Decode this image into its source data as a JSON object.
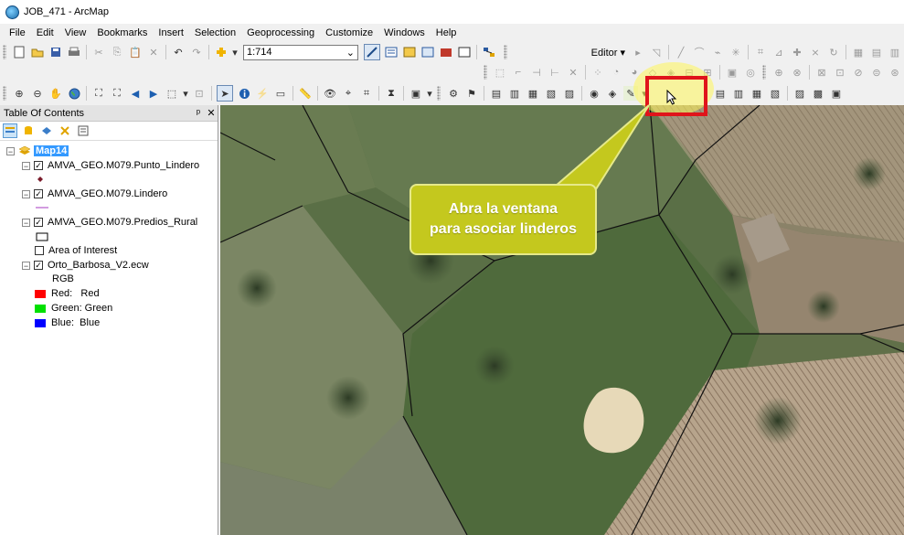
{
  "window": {
    "title": "JOB_471 - ArcMap"
  },
  "menu": [
    "File",
    "Edit",
    "View",
    "Bookmarks",
    "Insert",
    "Selection",
    "Geoprocessing",
    "Customize",
    "Windows",
    "Help"
  ],
  "standard_toolbar": {
    "scale": "1:714"
  },
  "editor_toolbar": {
    "label": "Editor ▾"
  },
  "toc": {
    "title": "Table Of Contents",
    "pin": "ᵖ",
    "close": "✕",
    "map_name": "Map14",
    "layers": [
      {
        "name": "AMVA_GEO.M079.Punto_Lindero",
        "checked": true
      },
      {
        "name": "AMVA_GEO.M079.Lindero",
        "checked": true
      },
      {
        "name": "AMVA_GEO.M079.Predios_Rural",
        "checked": true
      },
      {
        "name": "Area of Interest",
        "checked": false
      },
      {
        "name": "Orto_Barbosa_V2.ecw",
        "checked": true
      }
    ],
    "raster_legend": {
      "title": "RGB",
      "bands": [
        {
          "label": "Red:   Red",
          "color": "#ff0000"
        },
        {
          "label": "Green: Green",
          "color": "#00e000"
        },
        {
          "label": "Blue:  Blue",
          "color": "#0000ff"
        }
      ]
    }
  },
  "callout": {
    "line1": "Abra la ventana",
    "line2": "para asociar linderos"
  }
}
